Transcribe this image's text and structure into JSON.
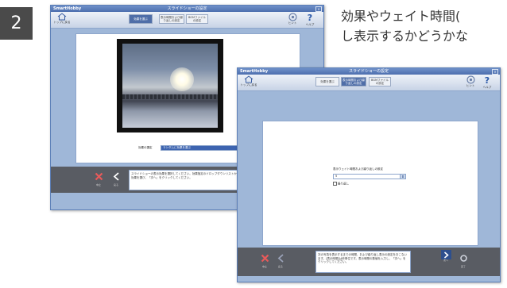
{
  "step_number": "2",
  "headline": {
    "line1": "効果やウェイト時間(",
    "line2": "し表示するかどうかな"
  },
  "window1": {
    "app_logo": "SmartHobby",
    "title": "スライドショーの設定",
    "home_label": "トップに戻る",
    "tabs": [
      {
        "label": "効果を選ぶ",
        "active": true
      },
      {
        "label": "表示時間および繰り返しの設定",
        "active": false
      },
      {
        "label": "BGMファイルの設定",
        "active": false
      }
    ],
    "tools": [
      {
        "label": "ヒント",
        "icon": "hint-icon"
      },
      {
        "label": "ヘルプ",
        "icon": "help-icon"
      }
    ],
    "effect_label": "効果の選定",
    "effect_value": "ランダムに効果を選ぶ",
    "nav": [
      {
        "label": "中止",
        "icon": "cancel-icon",
        "color": "#e85a5a"
      },
      {
        "label": "戻る",
        "icon": "back-icon",
        "color": "#ffffff"
      }
    ],
    "instruction": "スライドショーの表示効果を選択してください。効果指定のドロップダウンリストから効果を選び、「次へ」をクリックしてください。"
  },
  "window2": {
    "app_logo": "SmartHobby",
    "title": "スライドショーの設定",
    "home_label": "トップに戻る",
    "tabs": [
      {
        "label": "効果を選ぶ",
        "active": false
      },
      {
        "label": "表示時間および繰り返しの設定",
        "active": true
      },
      {
        "label": "BGMファイルの設定",
        "active": false
      }
    ],
    "tools": [
      {
        "label": "ヒント",
        "icon": "hint-icon"
      },
      {
        "label": "ヘルプ",
        "icon": "help-icon"
      }
    ],
    "wait_label": "表示ウェイト時間および繰り返しの設定",
    "wait_value": "5",
    "repeat_label": "繰り返し",
    "repeat_checked": false,
    "nav_left": [
      {
        "label": "中止",
        "icon": "cancel-icon",
        "color": "#e85a5a"
      },
      {
        "label": "戻る",
        "icon": "back-icon",
        "color": "#9aa2b8"
      }
    ],
    "nav_right": [
      {
        "label": "次へ",
        "icon": "next-icon",
        "color": "#ffffff"
      },
      {
        "label": "完了",
        "icon": "finish-icon",
        "color": "#cfd3dc"
      }
    ],
    "instruction": "次の写真を表示するまでの時間、および繰り返し表示の設定をおこないます。[表示時間]は秒単位です。表示時間の数値を入力し、「次へ」をクリックしてください。"
  },
  "colors": {
    "titlebar": "#5a7cbb",
    "active_tab": "#4f6ea8",
    "bottombar": "#595c63",
    "window_bg": "#9fb7d8"
  }
}
